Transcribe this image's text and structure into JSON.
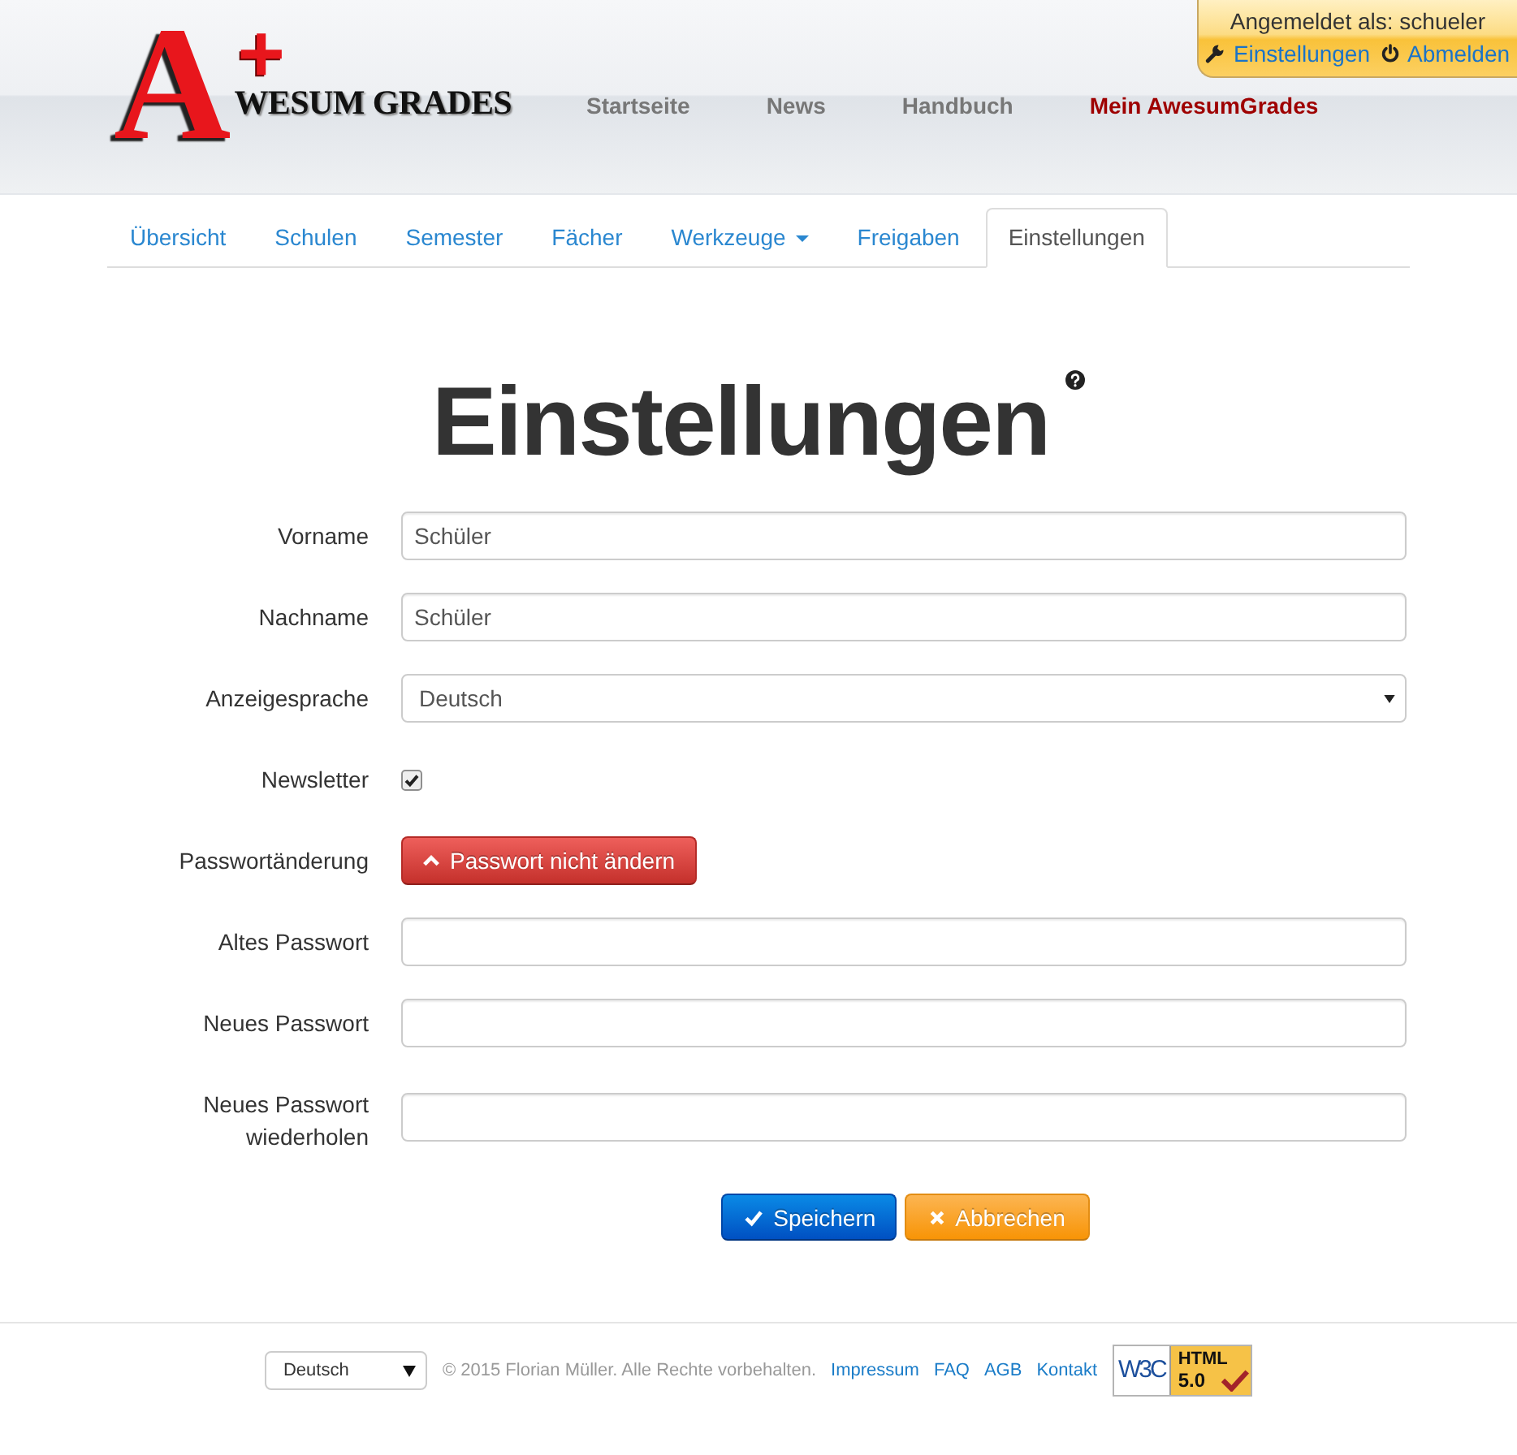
{
  "header": {
    "logo": {
      "letter": "A",
      "plus": "+",
      "wordmark": "WESUM GRADES"
    },
    "nav": [
      {
        "label": "Startseite",
        "selected": false
      },
      {
        "label": "News",
        "selected": false
      },
      {
        "label": "Handbuch",
        "selected": false
      },
      {
        "label": "Mein AwesumGrades",
        "selected": true
      }
    ],
    "user_box": {
      "status": "Angemeldet als: schueler",
      "links": [
        "Einstellungen",
        "Abmelden"
      ]
    }
  },
  "tabs": [
    {
      "label": "Übersicht",
      "selected": false,
      "dropdown": false
    },
    {
      "label": "Schulen",
      "selected": false,
      "dropdown": false
    },
    {
      "label": "Semester",
      "selected": false,
      "dropdown": false
    },
    {
      "label": "Fächer",
      "selected": false,
      "dropdown": false
    },
    {
      "label": "Werkzeuge",
      "selected": false,
      "dropdown": true
    },
    {
      "label": "Freigaben",
      "selected": false,
      "dropdown": false
    },
    {
      "label": "Einstellungen",
      "selected": true,
      "dropdown": false
    }
  ],
  "page": {
    "title": "Einstellungen"
  },
  "form": {
    "rows": [
      {
        "label": "Vorname",
        "kind": "text",
        "value": "Schüler"
      },
      {
        "label": "Nachname",
        "kind": "text",
        "value": "Schüler"
      },
      {
        "label": "Anzeigesprache",
        "kind": "select",
        "value": "Deutsch"
      },
      {
        "label": "Newsletter",
        "kind": "checkbox",
        "checked": true
      },
      {
        "label": "Passwortänderung",
        "kind": "toggle",
        "button": "Passwort nicht ändern"
      },
      {
        "label": "Altes Passwort",
        "kind": "password"
      },
      {
        "label": "Neues Passwort",
        "kind": "password"
      },
      {
        "label": "Neues Passwort wiederholen",
        "kind": "password"
      }
    ],
    "buttons": [
      {
        "label": "Speichern",
        "kind": "primary"
      },
      {
        "label": "Abbrechen",
        "kind": "warning"
      }
    ]
  },
  "footer": {
    "language": "Deutsch",
    "copyright": "© 2015 Florian Müller. Alle Rechte vorbehalten.",
    "links": [
      "Impressum",
      "FAQ",
      "AGB",
      "Kontakt"
    ],
    "badge": {
      "w3c": "W3C",
      "html": "HTML",
      "version": "5.0"
    }
  }
}
